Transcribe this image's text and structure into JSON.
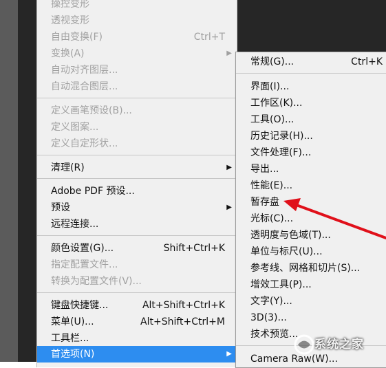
{
  "main_menu": {
    "items": [
      {
        "label": "操控变形",
        "shortcut": "",
        "disabled": true,
        "submenu": false
      },
      {
        "label": "透视变形",
        "shortcut": "",
        "disabled": true,
        "submenu": false
      },
      {
        "label": "自由变换(F)",
        "shortcut": "Ctrl+T",
        "disabled": true,
        "submenu": false
      },
      {
        "label": "变换(A)",
        "shortcut": "",
        "disabled": true,
        "submenu": true
      },
      {
        "label": "自动对齐图层...",
        "shortcut": "",
        "disabled": true,
        "submenu": false
      },
      {
        "label": "自动混合图层...",
        "shortcut": "",
        "disabled": true,
        "submenu": false
      },
      {
        "label": "定义画笔预设(B)...",
        "shortcut": "",
        "disabled": true,
        "submenu": false
      },
      {
        "label": "定义图案...",
        "shortcut": "",
        "disabled": true,
        "submenu": false
      },
      {
        "label": "定义自定形状...",
        "shortcut": "",
        "disabled": true,
        "submenu": false
      },
      {
        "label": "清理(R)",
        "shortcut": "",
        "disabled": false,
        "submenu": true
      },
      {
        "label": "Adobe PDF 预设...",
        "shortcut": "",
        "disabled": false,
        "submenu": false
      },
      {
        "label": "预设",
        "shortcut": "",
        "disabled": false,
        "submenu": true
      },
      {
        "label": "远程连接...",
        "shortcut": "",
        "disabled": false,
        "submenu": false
      },
      {
        "label": "颜色设置(G)...",
        "shortcut": "Shift+Ctrl+K",
        "disabled": false,
        "submenu": false
      },
      {
        "label": "指定配置文件...",
        "shortcut": "",
        "disabled": true,
        "submenu": false
      },
      {
        "label": "转换为配置文件(V)...",
        "shortcut": "",
        "disabled": true,
        "submenu": false
      },
      {
        "label": "键盘快捷键...",
        "shortcut": "Alt+Shift+Ctrl+K",
        "disabled": false,
        "submenu": false
      },
      {
        "label": "菜单(U)...",
        "shortcut": "Alt+Shift+Ctrl+M",
        "disabled": false,
        "submenu": false
      },
      {
        "label": "工具栏...",
        "shortcut": "",
        "disabled": false,
        "submenu": false
      },
      {
        "label": "首选项(N)",
        "shortcut": "",
        "disabled": false,
        "submenu": true,
        "highlighted": true
      }
    ]
  },
  "preferences_submenu": {
    "items": [
      {
        "label": "常规(G)...",
        "shortcut": "Ctrl+K"
      },
      {
        "label": "界面(I)...",
        "shortcut": ""
      },
      {
        "label": "工作区(K)...",
        "shortcut": ""
      },
      {
        "label": "工具(O)...",
        "shortcut": ""
      },
      {
        "label": "历史记录(H)...",
        "shortcut": ""
      },
      {
        "label": "文件处理(F)...",
        "shortcut": ""
      },
      {
        "label": "导出...",
        "shortcut": ""
      },
      {
        "label": "性能(E)...",
        "shortcut": ""
      },
      {
        "label": "暂存盘",
        "shortcut": ""
      },
      {
        "label": "光标(C)...",
        "shortcut": ""
      },
      {
        "label": "透明度与色域(T)...",
        "shortcut": ""
      },
      {
        "label": "单位与标尺(U)...",
        "shortcut": ""
      },
      {
        "label": "参考线、网格和切片(S)...",
        "shortcut": ""
      },
      {
        "label": "增效工具(P)...",
        "shortcut": ""
      },
      {
        "label": "文字(Y)...",
        "shortcut": ""
      },
      {
        "label": "3D(3)...",
        "shortcut": ""
      },
      {
        "label": "技术预览...",
        "shortcut": ""
      },
      {
        "label": "Camera Raw(W)...",
        "shortcut": ""
      }
    ]
  },
  "watermark": {
    "text": "系统之家"
  },
  "colors": {
    "highlight": "#2d8df0",
    "annotation_arrow": "#e0101a"
  },
  "icons": {
    "submenu_arrow": "submenu-arrow-icon"
  }
}
